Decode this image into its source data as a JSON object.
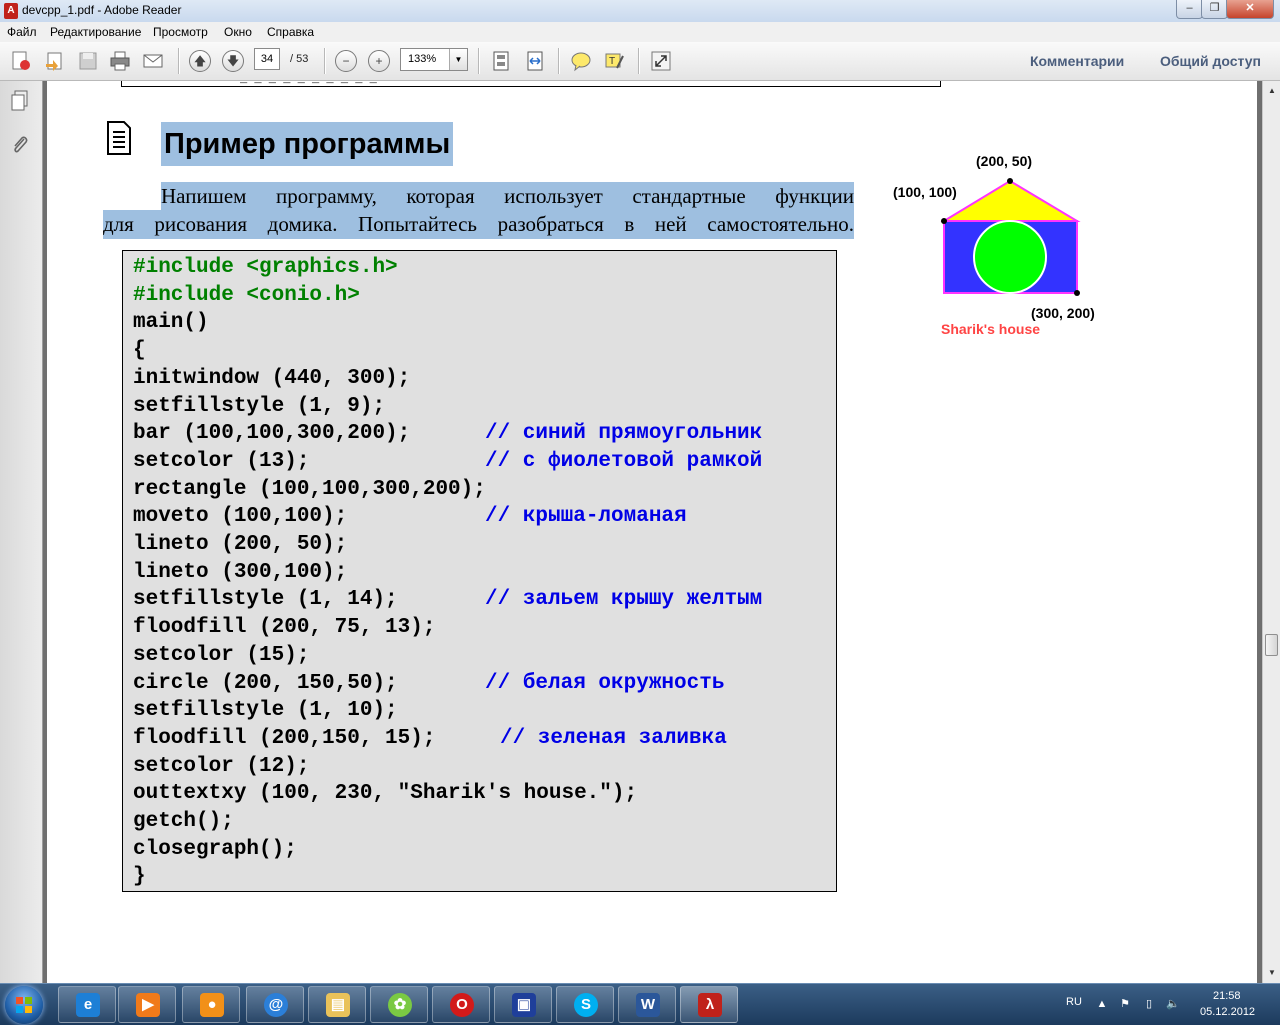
{
  "window": {
    "title": "devcpp_1.pdf - Adobe Reader",
    "app_icon_glyph": "A"
  },
  "menu": {
    "items": [
      "Файл",
      "Редактирование",
      "Просмотр",
      "Окно",
      "Справка"
    ]
  },
  "toolbar": {
    "current_page": "34",
    "page_total": "/ 53",
    "zoom": "133%",
    "comments_label": "Комментарии",
    "share_label": "Общий доступ"
  },
  "document": {
    "heading": "Пример программы",
    "paragraph_line1": "Напишем программу, которая использует стандартные функции",
    "paragraph_line2": "для рисования домика. Попытайтесь разобраться в ней самостоятельно.",
    "prev_box_text": "_ _ _ _ _ _ _ _ _ _",
    "code": [
      {
        "code": "#include <graphics.h>",
        "comment": ""
      },
      {
        "code": "#include <conio.h>",
        "comment": ""
      },
      {
        "code": "main()",
        "comment": ""
      },
      {
        "code": "{",
        "comment": ""
      },
      {
        "code": "initwindow (440, 300);",
        "comment": ""
      },
      {
        "code": "setfillstyle (1, 9);",
        "comment": ""
      },
      {
        "code": "bar (100,100,300,200);",
        "comment": "// синий прямоугольник"
      },
      {
        "code": "setcolor (13);",
        "comment": "// с фиолетовой рамкой"
      },
      {
        "code": "rectangle (100,100,300,200);",
        "comment": ""
      },
      {
        "code": "moveto (100,100);",
        "comment": "// крыша-ломаная"
      },
      {
        "code": "lineto (200, 50);",
        "comment": ""
      },
      {
        "code": "lineto (300,100);",
        "comment": ""
      },
      {
        "code": "setfillstyle (1, 14);",
        "comment": "// зальем крышу желтым"
      },
      {
        "code": "floodfill (200, 75, 13);",
        "comment": ""
      },
      {
        "code": "setcolor (15);",
        "comment": ""
      },
      {
        "code": "circle (200, 150,50);",
        "comment": "// белая окружность"
      },
      {
        "code": "setfillstyle (1, 10);",
        "comment": ""
      },
      {
        "code": "floodfill (200,150, 15);",
        "comment": "// зеленая заливка"
      },
      {
        "code": "setcolor (12);",
        "comment": ""
      },
      {
        "code": "outtextxy (100, 230, \"Sharik's house.\");",
        "comment": ""
      },
      {
        "code": "getch();",
        "comment": ""
      },
      {
        "code": "closegraph();",
        "comment": ""
      },
      {
        "code": "}",
        "comment": ""
      }
    ],
    "diagram": {
      "label_top": "(200, 50)",
      "label_left": "(100, 100)",
      "label_bottom": "(300, 200)",
      "caption": "Sharik's house"
    }
  },
  "taskbar": {
    "language": "RU",
    "time": "21:58",
    "date": "05.12.2012"
  },
  "colors": {
    "highlight": "#9ebfe0",
    "code_bg": "#e0e0e0",
    "code_green": "#008000",
    "comment_blue": "#0000e6",
    "caption_red": "#ff4444",
    "house_blue": "#3333ff",
    "house_border": "#ff33ff",
    "roof_yellow": "#ffff00",
    "circle_green": "#00ff00"
  }
}
